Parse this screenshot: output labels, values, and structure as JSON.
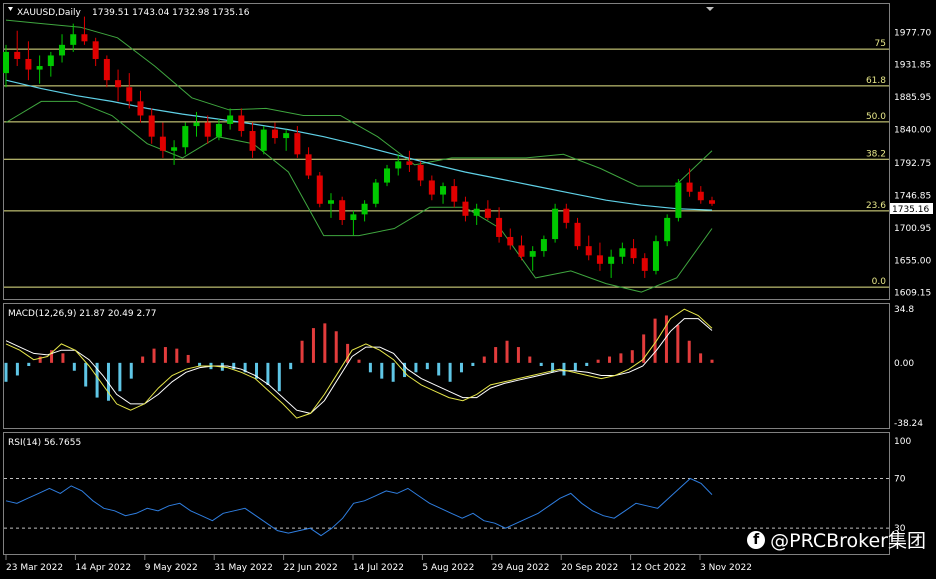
{
  "header": {
    "symbol": "XAUUSD,Daily",
    "ohlc": "1739.51 1743.04 1732.98 1735.16"
  },
  "current_price": "1735.16",
  "watermark": "@PRCBroker集团",
  "colors": {
    "bg": "#000000",
    "up": "#00c800",
    "down": "#e00000",
    "bb": "#3fa63f",
    "ma": "#5fd0e6",
    "fib": "#e8e88a",
    "macd_hist_pos": "#e23c3c",
    "macd_hist_neg": "#5fc6e6",
    "macd_signal": "#ffffff",
    "macd_line": "#e6e64a",
    "rsi": "#2f7ee0",
    "axis": "#c0c0c0"
  },
  "chart_data": [
    {
      "type": "candlestick",
      "title": "XAUUSD,Daily",
      "price_axis_ticks": [
        "1977.70",
        "1931.85",
        "1885.95",
        "1840.00",
        "1792.75",
        "1746.85",
        "1700.95",
        "1655.00",
        "1609.15"
      ],
      "ylim": [
        1603,
        2015
      ],
      "fib_levels": [
        {
          "label": "75",
          "price": 1954
        },
        {
          "label": "61.8",
          "price": 1902
        },
        {
          "label": "50.0",
          "price": 1851
        },
        {
          "label": "38.2",
          "price": 1798
        },
        {
          "label": "23.6",
          "price": 1725
        },
        {
          "label": "0.0",
          "price": 1617
        }
      ],
      "moving_average": [
        1910,
        1898,
        1888,
        1880,
        1870,
        1862,
        1855,
        1848,
        1840,
        1830,
        1818,
        1805,
        1792,
        1780,
        1770,
        1760,
        1750,
        1740,
        1733,
        1728,
        1726
      ],
      "bollinger_upper": [
        1995,
        1990,
        1985,
        1970,
        1930,
        1885,
        1868,
        1870,
        1860,
        1860,
        1830,
        1790,
        1800,
        1800,
        1800,
        1805,
        1785,
        1760,
        1760,
        1810
      ],
      "bollinger_lower": [
        1850,
        1880,
        1880,
        1860,
        1820,
        1800,
        1830,
        1820,
        1780,
        1690,
        1690,
        1700,
        1730,
        1730,
        1700,
        1630,
        1640,
        1622,
        1610,
        1630,
        1700
      ],
      "candles_ohlc": [
        [
          1920,
          1960,
          1900,
          1950
        ],
        [
          1950,
          1980,
          1930,
          1940
        ],
        [
          1940,
          1965,
          1910,
          1925
        ],
        [
          1925,
          1945,
          1905,
          1930
        ],
        [
          1930,
          1950,
          1915,
          1945
        ],
        [
          1945,
          1975,
          1935,
          1960
        ],
        [
          1960,
          1990,
          1950,
          1975
        ],
        [
          1975,
          2000,
          1960,
          1965
        ],
        [
          1965,
          1970,
          1930,
          1940
        ],
        [
          1940,
          1945,
          1900,
          1910
        ],
        [
          1910,
          1925,
          1880,
          1900
        ],
        [
          1900,
          1920,
          1870,
          1880
        ],
        [
          1880,
          1895,
          1850,
          1860
        ],
        [
          1860,
          1870,
          1820,
          1830
        ],
        [
          1830,
          1850,
          1800,
          1810
        ],
        [
          1810,
          1825,
          1790,
          1815
        ],
        [
          1815,
          1850,
          1805,
          1845
        ],
        [
          1845,
          1865,
          1830,
          1850
        ],
        [
          1850,
          1860,
          1820,
          1830
        ],
        [
          1830,
          1855,
          1825,
          1848
        ],
        [
          1848,
          1870,
          1840,
          1860
        ],
        [
          1860,
          1870,
          1830,
          1838
        ],
        [
          1838,
          1850,
          1800,
          1810
        ],
        [
          1810,
          1845,
          1805,
          1840
        ],
        [
          1840,
          1850,
          1820,
          1828
        ],
        [
          1828,
          1840,
          1810,
          1835
        ],
        [
          1835,
          1845,
          1800,
          1805
        ],
        [
          1805,
          1815,
          1770,
          1775
        ],
        [
          1775,
          1780,
          1730,
          1735
        ],
        [
          1735,
          1750,
          1715,
          1740
        ],
        [
          1740,
          1745,
          1705,
          1712
        ],
        [
          1712,
          1725,
          1690,
          1720
        ],
        [
          1720,
          1740,
          1710,
          1735
        ],
        [
          1735,
          1770,
          1730,
          1765
        ],
        [
          1765,
          1790,
          1760,
          1785
        ],
        [
          1785,
          1805,
          1775,
          1795
        ],
        [
          1795,
          1810,
          1780,
          1790
        ],
        [
          1790,
          1795,
          1760,
          1768
        ],
        [
          1768,
          1775,
          1740,
          1748
        ],
        [
          1748,
          1765,
          1735,
          1760
        ],
        [
          1760,
          1770,
          1730,
          1738
        ],
        [
          1738,
          1745,
          1710,
          1718
        ],
        [
          1718,
          1735,
          1705,
          1728
        ],
        [
          1728,
          1740,
          1712,
          1715
        ],
        [
          1715,
          1730,
          1680,
          1688
        ],
        [
          1688,
          1700,
          1670,
          1676
        ],
        [
          1676,
          1690,
          1655,
          1660
        ],
        [
          1660,
          1675,
          1640,
          1668
        ],
        [
          1668,
          1690,
          1660,
          1685
        ],
        [
          1685,
          1735,
          1680,
          1728
        ],
        [
          1728,
          1735,
          1700,
          1708
        ],
        [
          1708,
          1715,
          1670,
          1675
        ],
        [
          1675,
          1690,
          1655,
          1662
        ],
        [
          1662,
          1680,
          1640,
          1650
        ],
        [
          1650,
          1670,
          1630,
          1660
        ],
        [
          1660,
          1680,
          1650,
          1672
        ],
        [
          1672,
          1685,
          1650,
          1658
        ],
        [
          1658,
          1665,
          1630,
          1640
        ],
        [
          1640,
          1690,
          1635,
          1682
        ],
        [
          1682,
          1720,
          1675,
          1715
        ],
        [
          1715,
          1770,
          1710,
          1765
        ],
        [
          1765,
          1785,
          1745,
          1752
        ],
        [
          1752,
          1760,
          1735,
          1740
        ],
        [
          1740,
          1745,
          1732,
          1735
        ]
      ]
    },
    {
      "type": "bar",
      "title": "MACD(12,26,9) 21.87 20.49 2.77",
      "axis_ticks": [
        "34.8",
        "0.00",
        "-38.24"
      ],
      "ylim": [
        -40,
        36
      ],
      "histogram": [
        -12,
        -8,
        -2,
        4,
        8,
        6,
        -5,
        -15,
        -22,
        -24,
        -18,
        -10,
        4,
        9,
        10,
        9,
        5,
        -2,
        -4,
        -5,
        -4,
        -6,
        -10,
        -14,
        -18,
        -4,
        14,
        22,
        25,
        20,
        12,
        2,
        -6,
        -10,
        -12,
        -9,
        -6,
        -4,
        -8,
        -12,
        -6,
        -2,
        4,
        10,
        14,
        10,
        4,
        -2,
        -6,
        -8,
        -5,
        -2,
        2,
        4,
        6,
        8,
        18,
        28,
        30,
        24,
        14,
        6,
        2
      ],
      "macd_line": [
        12,
        8,
        2,
        4,
        12,
        8,
        -2,
        -14,
        -26,
        -30,
        -26,
        -16,
        -8,
        -4,
        -2,
        -2,
        -3,
        -6,
        -10,
        -18,
        -26,
        -35,
        -32,
        -20,
        -6,
        8,
        12,
        8,
        2,
        -8,
        -14,
        -18,
        -22,
        -24,
        -20,
        -14,
        -12,
        -10,
        -8,
        -6,
        -4,
        -6,
        -8,
        -10,
        -8,
        -4,
        2,
        14,
        28,
        34,
        30,
        21.87
      ],
      "signal_line": [
        14,
        10,
        6,
        5,
        8,
        8,
        2,
        -8,
        -20,
        -26,
        -26,
        -20,
        -12,
        -6,
        -3,
        -2,
        -2,
        -4,
        -8,
        -14,
        -22,
        -30,
        -32,
        -24,
        -10,
        4,
        10,
        10,
        6,
        -4,
        -10,
        -14,
        -18,
        -22,
        -22,
        -16,
        -13,
        -11,
        -9,
        -7,
        -5,
        -5,
        -6,
        -8,
        -8,
        -6,
        -2,
        8,
        20,
        28,
        28,
        20.49
      ]
    },
    {
      "type": "line",
      "title": "RSI(14) 56.7655",
      "axis_ticks": [
        "100",
        "70",
        "30"
      ],
      "ylim": [
        10,
        105
      ],
      "levels": [
        70,
        30
      ],
      "values": [
        52,
        50,
        54,
        58,
        62,
        58,
        64,
        60,
        52,
        46,
        44,
        40,
        42,
        46,
        44,
        48,
        50,
        44,
        40,
        36,
        42,
        44,
        46,
        40,
        34,
        28,
        26,
        28,
        30,
        24,
        30,
        38,
        50,
        52,
        56,
        60,
        58,
        62,
        56,
        50,
        46,
        42,
        38,
        42,
        36,
        34,
        30,
        34,
        38,
        42,
        48,
        54,
        58,
        50,
        44,
        40,
        38,
        44,
        50,
        48,
        46,
        54,
        62,
        70,
        66,
        57
      ]
    }
  ],
  "x_axis_labels": [
    "23 Mar 2022",
    "14 Apr 2022",
    "9 May 2022",
    "31 May 2022",
    "22 Jun 2022",
    "14 Jul 2022",
    "5 Aug 2022",
    "29 Aug 2022",
    "20 Sep 2022",
    "12 Oct 2022",
    "3 Nov 2022"
  ]
}
